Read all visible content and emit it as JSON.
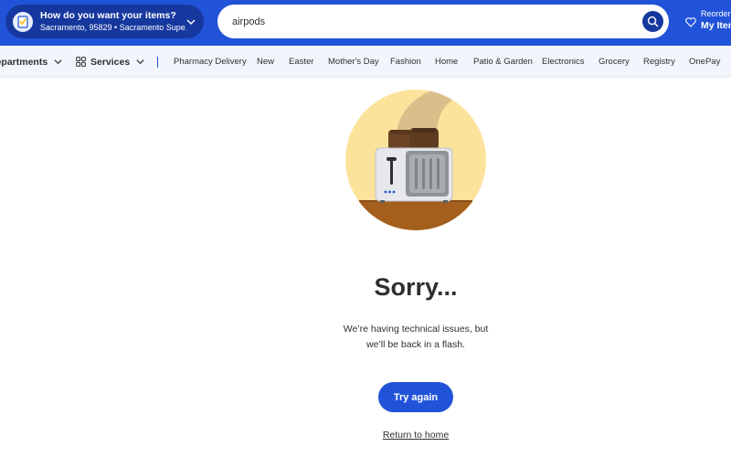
{
  "header": {
    "delivery_title": "How do you want your items?",
    "delivery_location": "Sacramento, 95829 • Sacramento Supe...",
    "search_value": "airpods",
    "reorder_label": "Reorder",
    "my_items_label": "My Items"
  },
  "nav": {
    "departments": "Departments",
    "services": "Services",
    "links": [
      "Pharmacy Delivery",
      "New",
      "Easter",
      "Mother's Day",
      "Fashion",
      "Home",
      "Patio & Garden",
      "Electronics",
      "Grocery",
      "Registry",
      "OnePay"
    ]
  },
  "main": {
    "title": "Sorry...",
    "message_line1": "We’re having technical issues, but",
    "message_line2": "we’ll be back in a flash.",
    "try_again": "Try again",
    "return_home": "Return to home"
  },
  "icons": {
    "delivery_badge": "checklist-icon",
    "chevron": "chevron-down-icon",
    "search": "search-icon",
    "heart": "heart-icon",
    "grid": "grid-icon",
    "illustration": "toaster-illustration"
  },
  "colors": {
    "brand_blue": "#2153d9",
    "dark_blue": "#16389e",
    "nav_bg": "#f2f6fc"
  }
}
